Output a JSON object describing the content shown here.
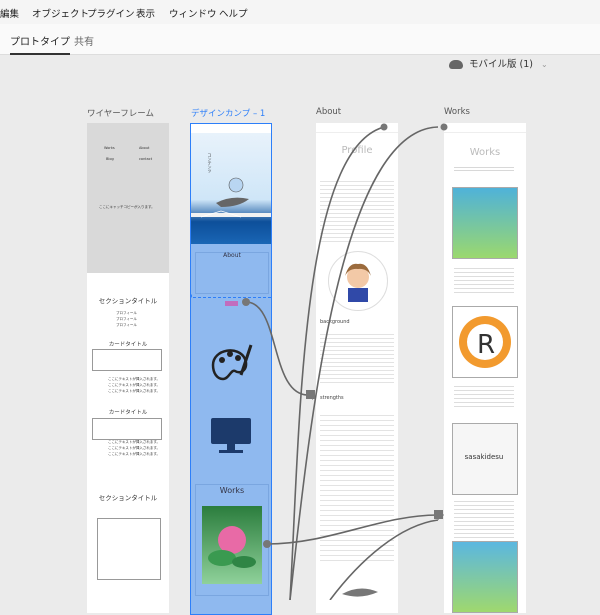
{
  "menu": [
    "編集",
    "オブジェクト",
    "プラグイン",
    "表示",
    "ウィンドウ",
    "ヘルプ"
  ],
  "tabs": {
    "prototype": "プロトタイプ",
    "share": "共有"
  },
  "device": {
    "label": "モバイル版 (1)"
  },
  "artboards": {
    "wire": {
      "label": "ワイヤーフレーム",
      "nav": [
        "Works",
        "About",
        "Blog",
        "contact"
      ],
      "catch": "ここにキャッチコピーが入ります。",
      "section_title": "セクションタイトル",
      "profile_lines": [
        "プロフィール",
        "プロフィール",
        "プロフィール"
      ],
      "card_title": "カードタイトル",
      "card_text": [
        "ここにテキストが挿入されます。",
        "ここにテキストが挿入されます。",
        "ここにテキストが挿入されます。"
      ]
    },
    "comp": {
      "label": "デザインカンプ – 1",
      "about": "About",
      "works": "Works"
    },
    "about": {
      "label": "About",
      "title": "Profile",
      "background": "background",
      "strengths": "strengths"
    },
    "works": {
      "label": "Works",
      "title": "Works",
      "logo_text": "sasakidesu"
    }
  }
}
